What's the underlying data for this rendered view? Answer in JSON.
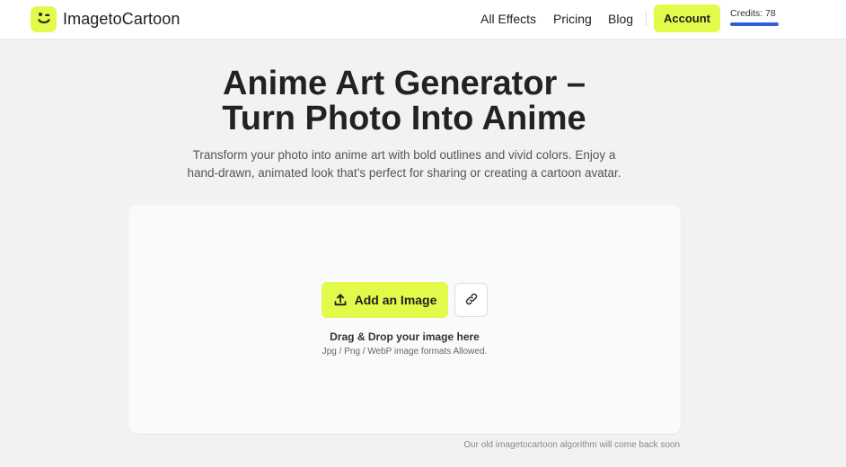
{
  "header": {
    "brand": "ImagetoCartoon",
    "nav": [
      {
        "label": "All Effects"
      },
      {
        "label": "Pricing"
      },
      {
        "label": "Blog"
      }
    ],
    "account_label": "Account",
    "credits_label": "Credits: 78",
    "credits_fill_percent": 100,
    "colors": {
      "accent": "#e4fa4a",
      "credits_bar": "#2f5fd6"
    }
  },
  "hero": {
    "title_line1": "Anime Art Generator –",
    "title_line2": "Turn Photo Into Anime",
    "subtitle_line1": "Transform your photo into anime art with bold outlines and vivid colors. Enjoy a",
    "subtitle_line2": "hand-drawn, animated look that’s perfect for sharing or creating a cartoon avatar."
  },
  "upload": {
    "add_label": "Add an Image",
    "add_icon": "upload-icon",
    "link_icon": "link-icon",
    "drop_text": "Drag & Drop your image here",
    "formats_text": "Jpg / Png / WebP image formats Allowed."
  },
  "footnote": "Our old imagetocartoon algorithm will come back soon"
}
